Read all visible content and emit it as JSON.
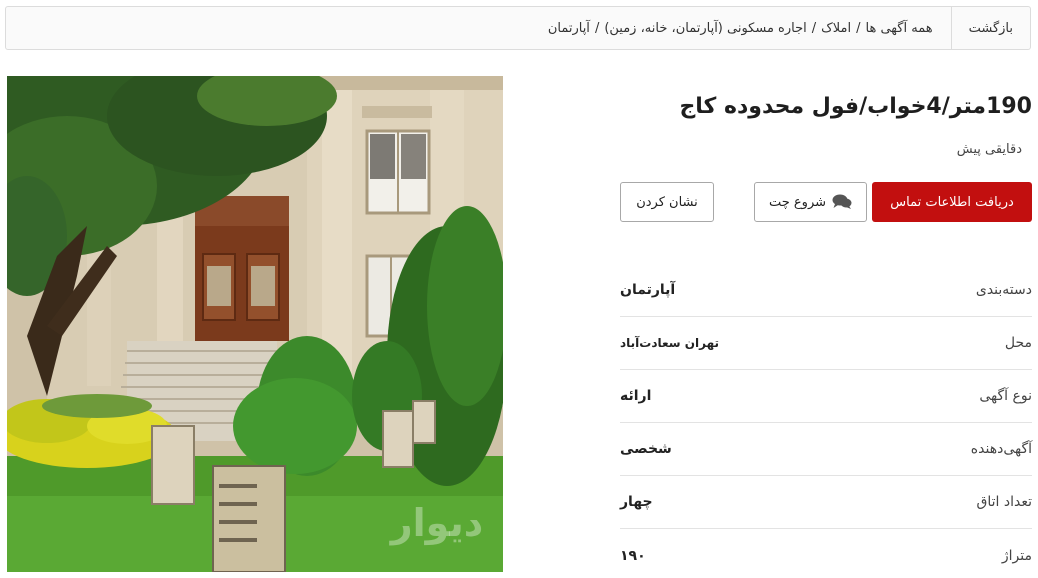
{
  "breadcrumb": {
    "back_label": "بازگشت",
    "items": [
      "همه آگهی ها",
      "املاک",
      "اجاره مسکونی (آپارتمان، خانه، زمین)",
      "آپارتمان"
    ],
    "separator": "/"
  },
  "listing": {
    "title": "190متر/4خواب/فول محدوده کاج",
    "posted": "دقایقی پیش",
    "photo_watermark": "دیوار"
  },
  "actions": {
    "contact_label": "دریافت اطلاعات تماس",
    "chat_label": "شروع چت",
    "chat_icon": "chat-icon",
    "bookmark_label": "نشان کردن"
  },
  "attributes": [
    {
      "label": "دسته‌بندی",
      "value": "آپارتمان"
    },
    {
      "label": "محل",
      "value": "تهران سعادت‌آباد"
    },
    {
      "label": "نوع آگهی",
      "value": "ارائه"
    },
    {
      "label": "آگهی‌دهنده",
      "value": "شخصی"
    },
    {
      "label": "تعداد اتاق",
      "value": "چهار"
    },
    {
      "label": "متراژ",
      "value": "۱۹۰"
    }
  ],
  "colors": {
    "primary_button": "#c20f0f",
    "border": "#dcdcdc"
  }
}
